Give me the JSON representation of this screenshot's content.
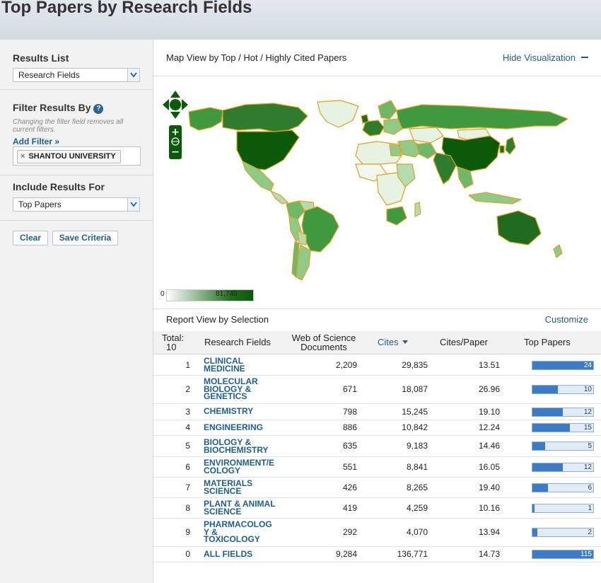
{
  "page": {
    "title": "Top Papers by Research Fields"
  },
  "sidebar": {
    "results_list": {
      "label": "Results List",
      "selected": "Research Fields"
    },
    "filter": {
      "label": "Filter Results By",
      "help_icon": "?",
      "note": "Changing the filter field removes all current filters.",
      "add_filter": "Add Filter »",
      "chips": [
        {
          "remove": "×",
          "label": "SHANTOU UNIVERSITY"
        }
      ]
    },
    "include": {
      "label": "Include Results For",
      "selected": "Top Papers"
    },
    "buttons": {
      "clear": "Clear",
      "save": "Save Criteria"
    }
  },
  "map": {
    "title": "Map View by Top / Hot / Highly Cited Papers",
    "hide_label": "Hide Visualization",
    "legend_min": "0",
    "legend_max": "81,740",
    "zoom_in": "+",
    "zoom_out": "−",
    "colors": {
      "high": "#0a5a0a",
      "mid": "#3f9a3f",
      "low": "#b5dcb0",
      "border": "#e0a020"
    }
  },
  "report": {
    "title": "Report View by Selection",
    "customize": "Customize",
    "total_label": "Total:",
    "total_value": "10",
    "columns": {
      "field": "Research Fields",
      "docs_line1": "Web of Science",
      "docs_line2": "Documents",
      "cites": "Cites",
      "cpp": "Cites/Paper",
      "top": "Top Papers"
    },
    "rows": [
      {
        "rank": "1",
        "field_lines": [
          "CLINICAL",
          "MEDICINE"
        ],
        "docs": "2,209",
        "cites": "29,835",
        "cpp": "13.51",
        "top": "24",
        "pct": 100
      },
      {
        "rank": "2",
        "field_lines": [
          "MOLECULAR",
          "BIOLOGY &",
          "GENETICS"
        ],
        "docs": "671",
        "cites": "18,087",
        "cpp": "26.96",
        "top": "10",
        "pct": 42
      },
      {
        "rank": "3",
        "field_lines": [
          "CHEMISTRY"
        ],
        "docs": "798",
        "cites": "15,245",
        "cpp": "19.10",
        "top": "12",
        "pct": 50
      },
      {
        "rank": "4",
        "field_lines": [
          "ENGINEERING"
        ],
        "docs": "886",
        "cites": "10,842",
        "cpp": "12.24",
        "top": "15",
        "pct": 62
      },
      {
        "rank": "5",
        "field_lines": [
          "BIOLOGY &",
          "BIOCHEMISTRY"
        ],
        "docs": "635",
        "cites": "9,183",
        "cpp": "14.46",
        "top": "5",
        "pct": 21
      },
      {
        "rank": "6",
        "field_lines": [
          "ENVIRONMENT/E",
          "COLOGY"
        ],
        "docs": "551",
        "cites": "8,841",
        "cpp": "16.05",
        "top": "12",
        "pct": 50
      },
      {
        "rank": "7",
        "field_lines": [
          "MATERIALS",
          "SCIENCE"
        ],
        "docs": "426",
        "cites": "8,265",
        "cpp": "19.40",
        "top": "6",
        "pct": 25
      },
      {
        "rank": "8",
        "field_lines": [
          "PLANT & ANIMAL",
          "SCIENCE"
        ],
        "docs": "419",
        "cites": "4,259",
        "cpp": "10.16",
        "top": "1",
        "pct": 4
      },
      {
        "rank": "9",
        "field_lines": [
          "PHARMACOLOG",
          "Y &",
          "TOXICOLOGY"
        ],
        "docs": "292",
        "cites": "4,070",
        "cpp": "13.94",
        "top": "2",
        "pct": 8
      },
      {
        "rank": "0",
        "field_lines": [
          "ALL FIELDS"
        ],
        "docs": "9,284",
        "cites": "136,771",
        "cpp": "14.73",
        "top": "115",
        "pct": 100
      }
    ]
  }
}
